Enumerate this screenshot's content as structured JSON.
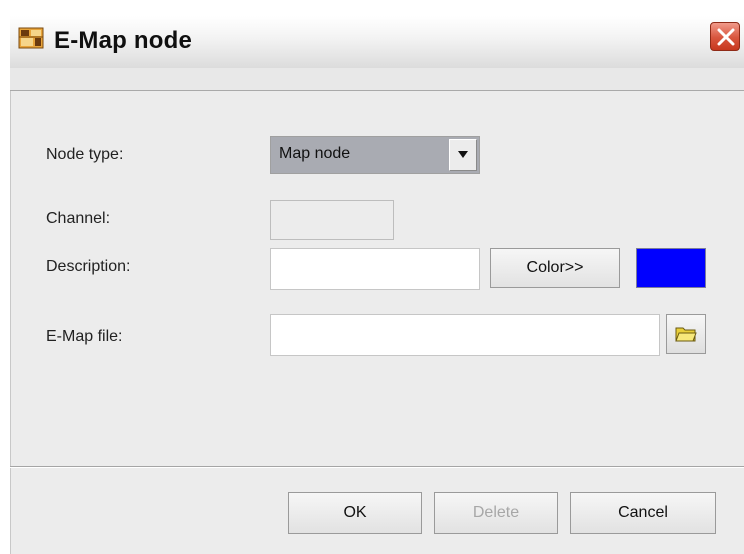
{
  "window": {
    "title": "E-Map node",
    "icon": "emap-app-icon",
    "close_icon": "close-icon"
  },
  "form": {
    "node_type": {
      "label": "Node type:",
      "value": "Map node"
    },
    "channel": {
      "label": "Channel:",
      "value": ""
    },
    "description": {
      "label": "Description:",
      "value": "",
      "color_button_label": "Color>>",
      "selected_color": "#0000ff"
    },
    "emap_file": {
      "label": "E-Map file:",
      "value": "",
      "browse_icon": "folder-icon"
    }
  },
  "footer": {
    "ok_label": "OK",
    "delete_label": "Delete",
    "cancel_label": "Cancel"
  },
  "colors": {
    "close_button": "#d8553d",
    "swatch": "#0000ff",
    "select_highlight": "#a9abb2"
  }
}
